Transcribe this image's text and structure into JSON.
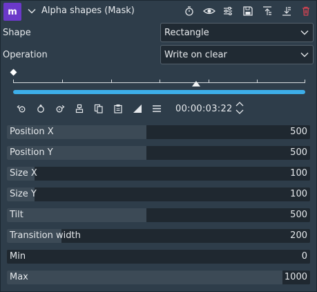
{
  "header": {
    "badge": "m",
    "title": "Alpha shapes (Mask)",
    "buttons": [
      "timer-icon",
      "eye-icon",
      "sliders-icon",
      "save-icon",
      "move-up-icon",
      "move-down-icon",
      "delete-icon"
    ]
  },
  "params": {
    "shape": {
      "label": "Shape",
      "value": "Rectangle"
    },
    "operation": {
      "label": "Operation",
      "value": "Write on clear"
    }
  },
  "timeline": {
    "timecode": "00:00:03:22",
    "playhead_fraction": 0.63
  },
  "toolbar": [
    "previous-keyframe-icon",
    "add-keyframe-icon",
    "next-keyframe-icon",
    "align-icon",
    "copy-icon",
    "paste-icon",
    "interpolation-icon",
    "menu-icon"
  ],
  "sliders": [
    {
      "name": "Position X",
      "value": "500",
      "fill": 0.46
    },
    {
      "name": "Position Y",
      "value": "500",
      "fill": 0.46
    },
    {
      "name": "Size X",
      "value": "100",
      "fill": 0.09
    },
    {
      "name": "Size Y",
      "value": "100",
      "fill": 0.09
    },
    {
      "name": "Tilt",
      "value": "500",
      "fill": 0.46
    },
    {
      "name": "Transition width",
      "value": "200",
      "fill": 0.18
    },
    {
      "name": "Min",
      "value": "0",
      "fill": 0.0
    },
    {
      "name": "Max",
      "value": "1000",
      "fill": 0.91
    }
  ],
  "colors": {
    "accent": "#3daee9",
    "badge": "#6b39c9",
    "delete": "#da4453"
  }
}
